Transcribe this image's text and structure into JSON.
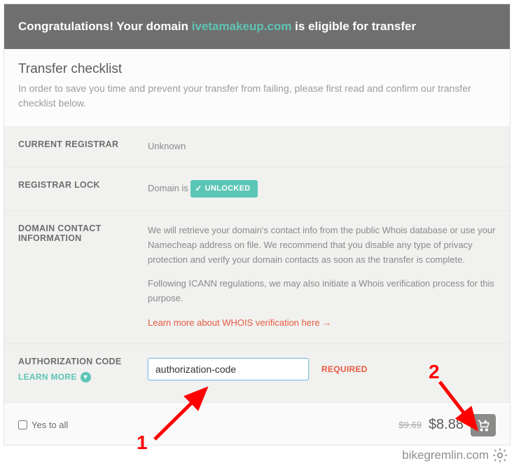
{
  "banner": {
    "prefix": "Congratulations! Your domain ",
    "domain": "ivetamakeup.com",
    "suffix": " is eligible for transfer"
  },
  "intro": {
    "heading": "Transfer checklist",
    "desc": "In order to save you time and prevent your transfer from failing, please first read and confirm our transfer checklist below."
  },
  "rows": {
    "registrar_label": "CURRENT REGISTRAR",
    "registrar_value": "Unknown",
    "lock_label": "REGISTRAR LOCK",
    "lock_prefix": "Domain is ",
    "lock_badge": "UNLOCKED",
    "contact_label": "DOMAIN CONTACT INFORMATION",
    "contact_p1": "We will retrieve your domain's contact info from the public Whois database or use your Namecheap address on file. We recommend that you disable any type of privacy protection and verify your domain contacts as soon as the transfer is complete.",
    "contact_p2": "Following ICANN regulations, we may also initiate a Whois verification process for this purpose.",
    "contact_link": "Learn more about WHOIS verification here →",
    "auth_label": "AUTHORIZATION CODE",
    "auth_placeholder": "authorization-code",
    "auth_value": "authorization-code",
    "required": "REQUIRED",
    "learn_more": "LEARN MORE"
  },
  "footer": {
    "yes_all": "Yes to all",
    "old_price": "$9.69",
    "new_price": "$8.88"
  },
  "annotations": {
    "num1": "1",
    "num2": "2"
  },
  "watermark": "bikegremlin.com"
}
